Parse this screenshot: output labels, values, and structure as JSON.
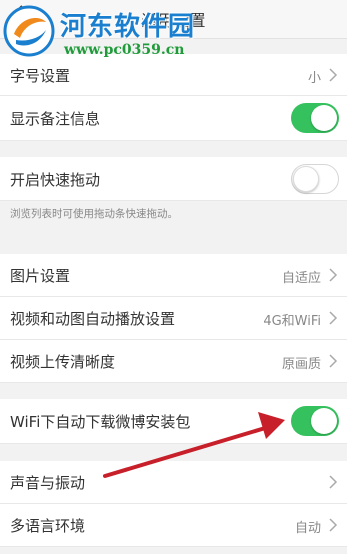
{
  "header": {
    "title": "通用设置",
    "back_glyph": "〈"
  },
  "watermark": {
    "title": "河东软件园",
    "url": "www.pc0359.cn"
  },
  "rows": {
    "font_size": {
      "label": "字号设置",
      "value": "小"
    },
    "show_remarks": {
      "label": "显示备注信息",
      "toggle": "on"
    },
    "quick_drag": {
      "label": "开启快速拖动",
      "toggle": "off",
      "hint": "浏览列表时可使用拖动条快速拖动。"
    },
    "image_settings": {
      "label": "图片设置",
      "value": "自适应"
    },
    "autoplay": {
      "label": "视频和动图自动播放设置",
      "value": "4G和WiFi"
    },
    "upload_quality": {
      "label": "视频上传清晰度",
      "value": "原画质"
    },
    "wifi_download": {
      "label": "WiFi下自动下载微博安装包",
      "toggle": "on"
    },
    "sound_vibration": {
      "label": "声音与振动"
    },
    "language": {
      "label": "多语言环境",
      "value": "自动"
    }
  },
  "colors": {
    "toggle_on": "#35c25e",
    "annotation_arrow": "#c8202a",
    "watermark_blue": "#1b7fcf",
    "watermark_green": "#1f9b3a"
  }
}
